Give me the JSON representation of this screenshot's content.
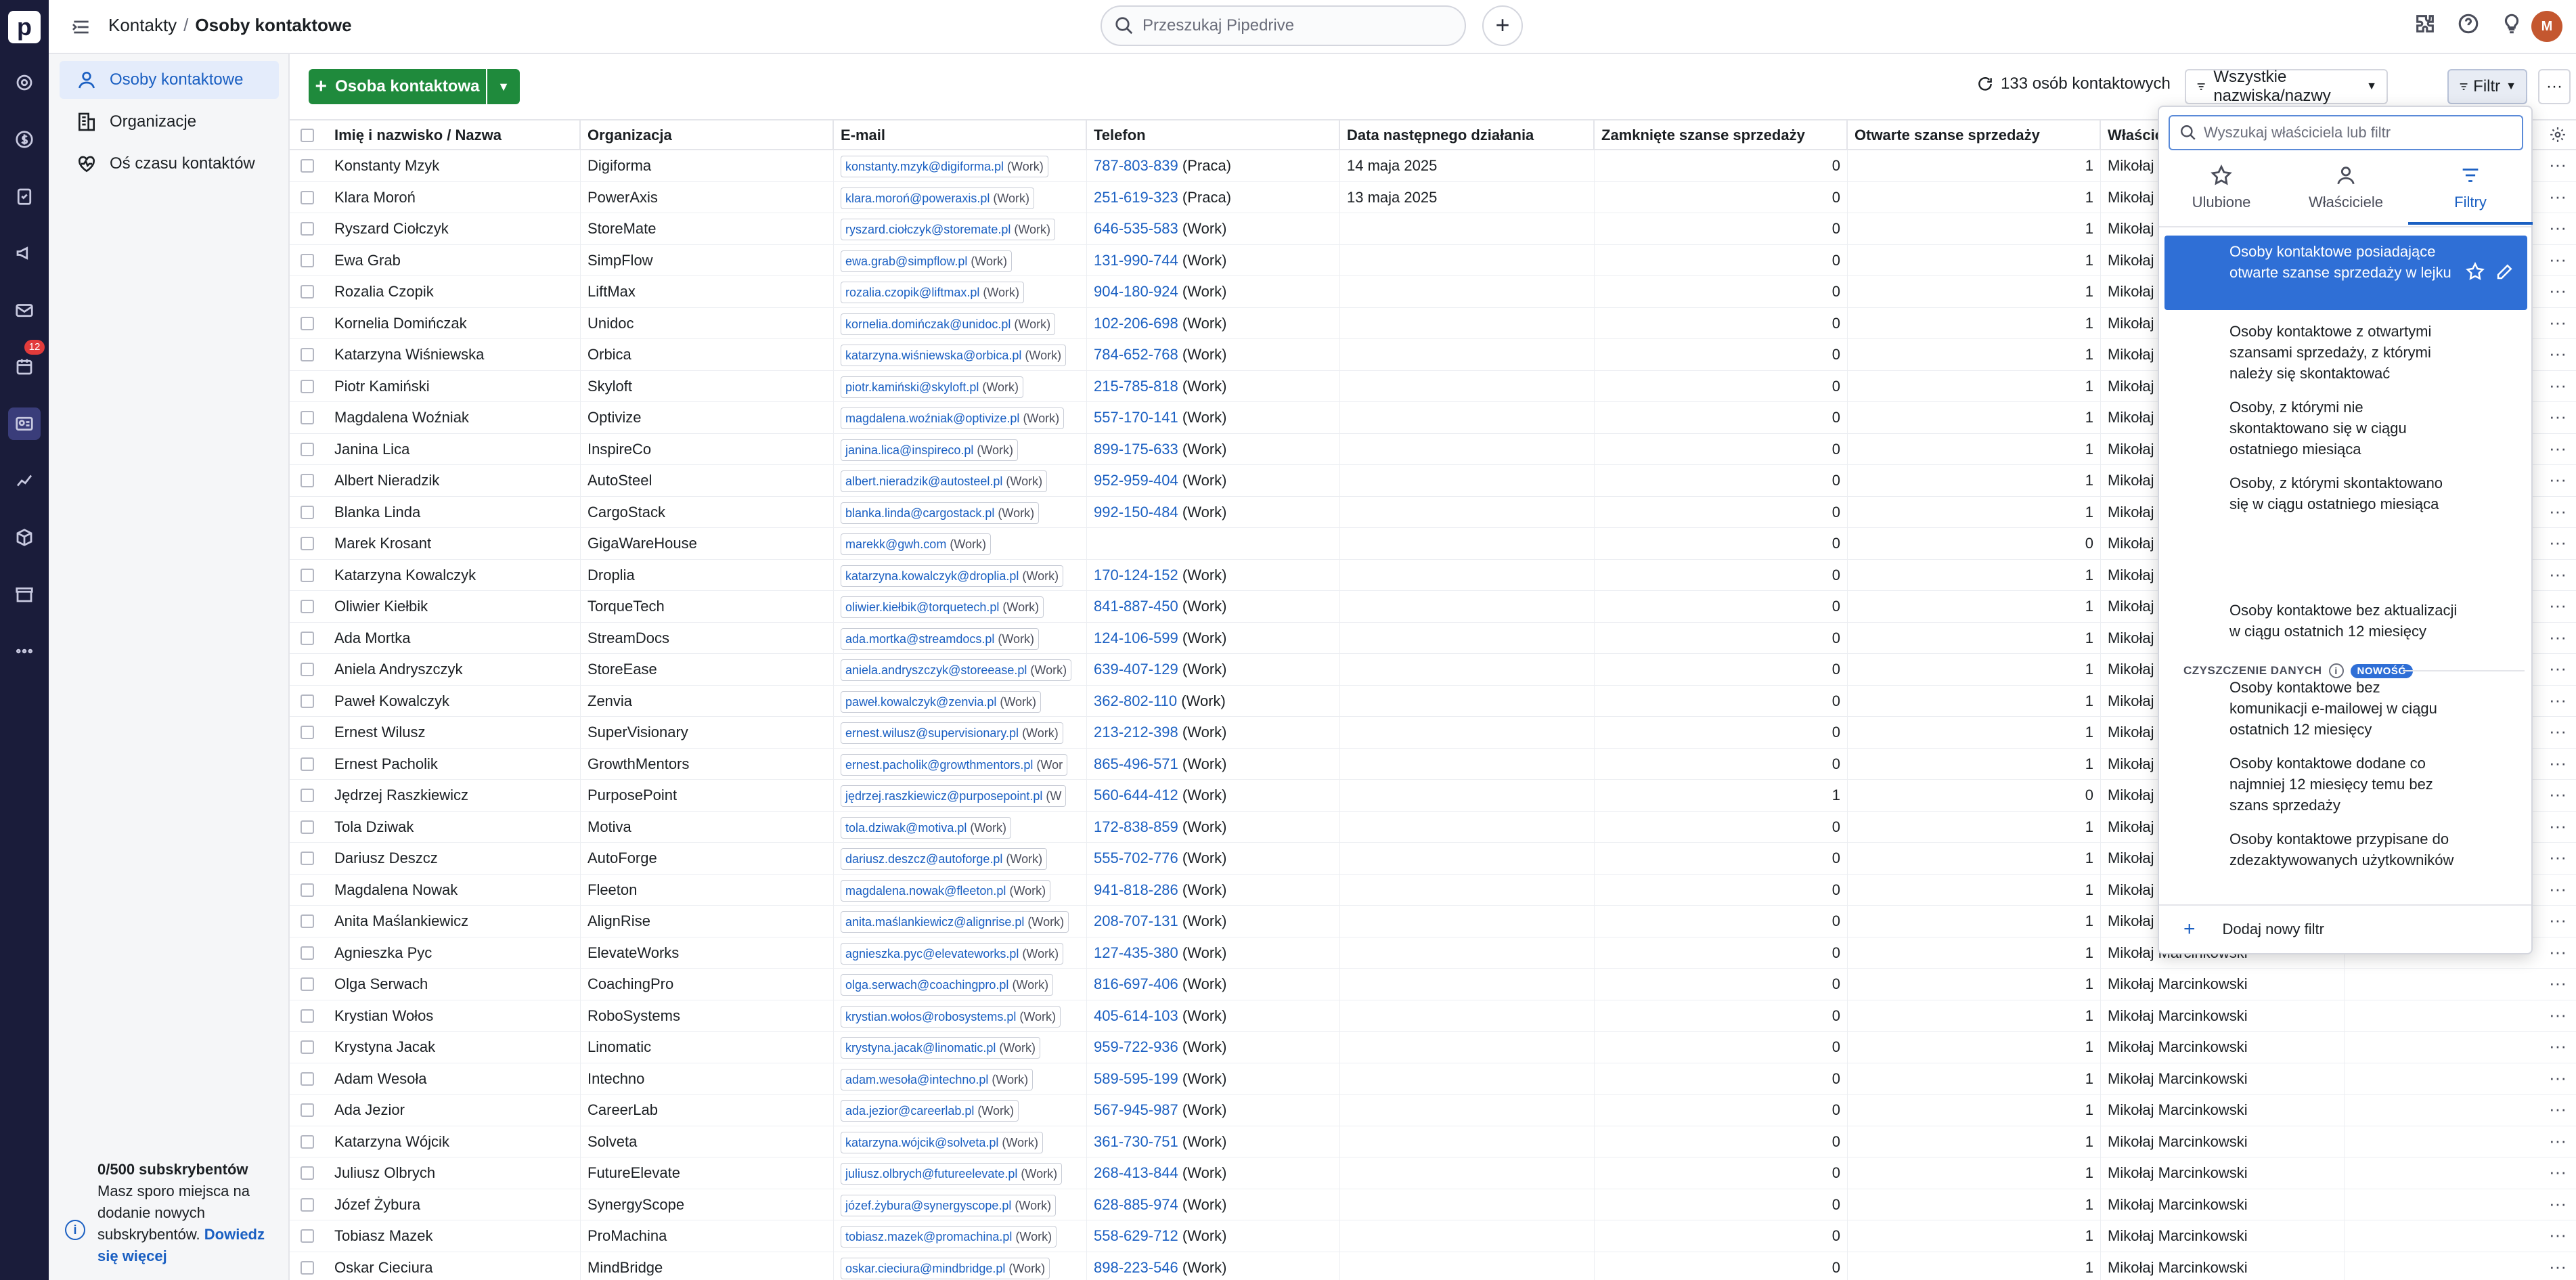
{
  "rail": {
    "logo": "p",
    "badge": "12"
  },
  "header": {
    "breadcrumb_parent": "Kontakty",
    "breadcrumb_separator": "/",
    "breadcrumb_current": "Osoby kontaktowe",
    "search_placeholder": "Przeszukaj Pipedrive",
    "add_label": "+"
  },
  "sidebar": {
    "items": [
      {
        "label": "Osoby kontaktowe",
        "icon": "person-icon",
        "active": true
      },
      {
        "label": "Organizacje",
        "icon": "building-icon",
        "active": false
      },
      {
        "label": "Oś czasu kontaktów",
        "icon": "heart-pulse-icon",
        "active": false
      }
    ],
    "subs_title": "0/500 subskrybentów",
    "subs_text": "Masz sporo miejsca na dodanie nowych subskrybentów.",
    "subs_link": "Dowiedz się więcej"
  },
  "toolbar": {
    "add_button": "Osoba kontaktowa",
    "count": "133 osób kontaktowych",
    "owner_filter": "Wszystkie nazwiska/nazwy",
    "filter_button": "Filtr",
    "more": "···"
  },
  "table": {
    "columns": [
      "Imię i nazwisko / Nazwa",
      "Organizacja",
      "E-mail",
      "Telefon",
      "Data następnego działania",
      "Zamknięte szanse sprzedaży",
      "Otwarte szanse sprzedaży",
      "Właściciel"
    ],
    "rows": [
      {
        "name": "Konstanty Mzyk",
        "org": "Digiforma",
        "email": "konstanty.mzyk@digiforma.pl",
        "email_label": "(Work)",
        "phone": "787-803-839",
        "phone_label": "(Praca)",
        "next": "14 maja 2025",
        "closed": "0",
        "open": "1",
        "owner": "Mikołaj Marcinkowski"
      },
      {
        "name": "Klara Moroń",
        "org": "PowerAxis",
        "email": "klara.moroń@poweraxis.pl",
        "email_label": "(Work)",
        "phone": "251-619-323",
        "phone_label": "(Praca)",
        "next": "13 maja 2025",
        "closed": "0",
        "open": "1",
        "owner": "Mikołaj Marcinkowski"
      },
      {
        "name": "Ryszard Ciołczyk",
        "org": "StoreMate",
        "email": "ryszard.ciołczyk@storemate.pl",
        "email_label": "(Work)",
        "phone": "646-535-583",
        "phone_label": "(Work)",
        "next": "",
        "closed": "0",
        "open": "1",
        "owner": "Mikołaj Marcinkowski"
      },
      {
        "name": "Ewa Grab",
        "org": "SimpFlow",
        "email": "ewa.grab@simpflow.pl",
        "email_label": "(Work)",
        "phone": "131-990-744",
        "phone_label": "(Work)",
        "next": "",
        "closed": "0",
        "open": "1",
        "owner": "Mikołaj Marcinkowski"
      },
      {
        "name": "Rozalia Czopik",
        "org": "LiftMax",
        "email": "rozalia.czopik@liftmax.pl",
        "email_label": "(Work)",
        "phone": "904-180-924",
        "phone_label": "(Work)",
        "next": "",
        "closed": "0",
        "open": "1",
        "owner": "Mikołaj Marcinkowski"
      },
      {
        "name": "Kornelia Domińczak",
        "org": "Unidoc",
        "email": "kornelia.domińczak@unidoc.pl",
        "email_label": "(Work)",
        "phone": "102-206-698",
        "phone_label": "(Work)",
        "next": "",
        "closed": "0",
        "open": "1",
        "owner": "Mikołaj Marcinkowski"
      },
      {
        "name": "Katarzyna Wiśniewska",
        "org": "Orbica",
        "email": "katarzyna.wiśniewska@orbica.pl",
        "email_label": "(Work)",
        "phone": "784-652-768",
        "phone_label": "(Work)",
        "next": "",
        "closed": "0",
        "open": "1",
        "owner": "Mikołaj Marcinkowski"
      },
      {
        "name": "Piotr Kamiński",
        "org": "Skyloft",
        "email": "piotr.kamiński@skyloft.pl",
        "email_label": "(Work)",
        "phone": "215-785-818",
        "phone_label": "(Work)",
        "next": "",
        "closed": "0",
        "open": "1",
        "owner": "Mikołaj Marcinkowski"
      },
      {
        "name": "Magdalena Woźniak",
        "org": "Optivize",
        "email": "magdalena.woźniak@optivize.pl",
        "email_label": "(Work)",
        "phone": "557-170-141",
        "phone_label": "(Work)",
        "next": "",
        "closed": "0",
        "open": "1",
        "owner": "Mikołaj Marcinkowski"
      },
      {
        "name": "Janina Lica",
        "org": "InspireCo",
        "email": "janina.lica@inspireco.pl",
        "email_label": "(Work)",
        "phone": "899-175-633",
        "phone_label": "(Work)",
        "next": "",
        "closed": "0",
        "open": "1",
        "owner": "Mikołaj Marcinkowski"
      },
      {
        "name": "Albert Nieradzik",
        "org": "AutoSteel",
        "email": "albert.nieradzik@autosteel.pl",
        "email_label": "(Work)",
        "phone": "952-959-404",
        "phone_label": "(Work)",
        "next": "",
        "closed": "0",
        "open": "1",
        "owner": "Mikołaj Marcinkowski"
      },
      {
        "name": "Blanka Linda",
        "org": "CargoStack",
        "email": "blanka.linda@cargostack.pl",
        "email_label": "(Work)",
        "phone": "992-150-484",
        "phone_label": "(Work)",
        "next": "",
        "closed": "0",
        "open": "1",
        "owner": "Mikołaj Marcinkowski"
      },
      {
        "name": "Marek Krosant",
        "org": "GigaWareHouse",
        "email": "marekk@gwh.com",
        "email_label": "(Work)",
        "phone": "",
        "phone_label": "",
        "next": "",
        "closed": "0",
        "open": "0",
        "owner": "Mikołaj Marcinkowski"
      },
      {
        "name": "Katarzyna Kowalczyk",
        "org": "Droplia",
        "email": "katarzyna.kowalczyk@droplia.pl",
        "email_label": "(Work)",
        "phone": "170-124-152",
        "phone_label": "(Work)",
        "next": "",
        "closed": "0",
        "open": "1",
        "owner": "Mikołaj Marcinkowski"
      },
      {
        "name": "Oliwier Kiełbik",
        "org": "TorqueTech",
        "email": "oliwier.kiełbik@torquetech.pl",
        "email_label": "(Work)",
        "phone": "841-887-450",
        "phone_label": "(Work)",
        "next": "",
        "closed": "0",
        "open": "1",
        "owner": "Mikołaj Marcinkowski"
      },
      {
        "name": "Ada Mortka",
        "org": "StreamDocs",
        "email": "ada.mortka@streamdocs.pl",
        "email_label": "(Work)",
        "phone": "124-106-599",
        "phone_label": "(Work)",
        "next": "",
        "closed": "0",
        "open": "1",
        "owner": "Mikołaj Marcinkowski"
      },
      {
        "name": "Aniela Andryszczyk",
        "org": "StoreEase",
        "email": "aniela.andryszczyk@storeease.pl",
        "email_label": "(Work)",
        "phone": "639-407-129",
        "phone_label": "(Work)",
        "next": "",
        "closed": "0",
        "open": "1",
        "owner": "Mikołaj Marcinkowski"
      },
      {
        "name": "Paweł Kowalczyk",
        "org": "Zenvia",
        "email": "paweł.kowalczyk@zenvia.pl",
        "email_label": "(Work)",
        "phone": "362-802-110",
        "phone_label": "(Work)",
        "next": "",
        "closed": "0",
        "open": "1",
        "owner": "Mikołaj Marcinkowski"
      },
      {
        "name": "Ernest Wilusz",
        "org": "SuperVisionary",
        "email": "ernest.wilusz@supervisionary.pl",
        "email_label": "(Work)",
        "phone": "213-212-398",
        "phone_label": "(Work)",
        "next": "",
        "closed": "0",
        "open": "1",
        "owner": "Mikołaj Marcinkowski"
      },
      {
        "name": "Ernest Pacholik",
        "org": "GrowthMentors",
        "email": "ernest.pacholik@growthmentors.pl",
        "email_label": "(Wor",
        "phone": "865-496-571",
        "phone_label": "(Work)",
        "next": "",
        "closed": "0",
        "open": "1",
        "owner": "Mikołaj Marcinkowski"
      },
      {
        "name": "Jędrzej Raszkiewicz",
        "org": "PurposePoint",
        "email": "jędrzej.raszkiewicz@purposepoint.pl",
        "email_label": "(W",
        "phone": "560-644-412",
        "phone_label": "(Work)",
        "next": "",
        "closed": "1",
        "open": "0",
        "owner": "Mikołaj Marcinkowski"
      },
      {
        "name": "Tola Dziwak",
        "org": "Motiva",
        "email": "tola.dziwak@motiva.pl",
        "email_label": "(Work)",
        "phone": "172-838-859",
        "phone_label": "(Work)",
        "next": "",
        "closed": "0",
        "open": "1",
        "owner": "Mikołaj Marcinkowski"
      },
      {
        "name": "Dariusz Deszcz",
        "org": "AutoForge",
        "email": "dariusz.deszcz@autoforge.pl",
        "email_label": "(Work)",
        "phone": "555-702-776",
        "phone_label": "(Work)",
        "next": "",
        "closed": "0",
        "open": "1",
        "owner": "Mikołaj Marcinkowski"
      },
      {
        "name": "Magdalena Nowak",
        "org": "Fleeton",
        "email": "magdalena.nowak@fleeton.pl",
        "email_label": "(Work)",
        "phone": "941-818-286",
        "phone_label": "(Work)",
        "next": "",
        "closed": "0",
        "open": "1",
        "owner": "Mikołaj Marcinkowski"
      },
      {
        "name": "Anita Maślankiewicz",
        "org": "AlignRise",
        "email": "anita.maślankiewicz@alignrise.pl",
        "email_label": "(Work)",
        "phone": "208-707-131",
        "phone_label": "(Work)",
        "next": "",
        "closed": "0",
        "open": "1",
        "owner": "Mikołaj Marcinkowski"
      },
      {
        "name": "Agnieszka Pyc",
        "org": "ElevateWorks",
        "email": "agnieszka.pyc@elevateworks.pl",
        "email_label": "(Work)",
        "phone": "127-435-380",
        "phone_label": "(Work)",
        "next": "",
        "closed": "0",
        "open": "1",
        "owner": "Mikołaj Marcinkowski"
      },
      {
        "name": "Olga Serwach",
        "org": "CoachingPro",
        "email": "olga.serwach@coachingpro.pl",
        "email_label": "(Work)",
        "phone": "816-697-406",
        "phone_label": "(Work)",
        "next": "",
        "closed": "0",
        "open": "1",
        "owner": "Mikołaj Marcinkowski"
      },
      {
        "name": "Krystian Wołos",
        "org": "RoboSystems",
        "email": "krystian.wołos@robosystems.pl",
        "email_label": "(Work)",
        "phone": "405-614-103",
        "phone_label": "(Work)",
        "next": "",
        "closed": "0",
        "open": "1",
        "owner": "Mikołaj Marcinkowski"
      },
      {
        "name": "Krystyna Jacak",
        "org": "Linomatic",
        "email": "krystyna.jacak@linomatic.pl",
        "email_label": "(Work)",
        "phone": "959-722-936",
        "phone_label": "(Work)",
        "next": "",
        "closed": "0",
        "open": "1",
        "owner": "Mikołaj Marcinkowski"
      },
      {
        "name": "Adam Wesoła",
        "org": "Intechno",
        "email": "adam.wesoła@intechno.pl",
        "email_label": "(Work)",
        "phone": "589-595-199",
        "phone_label": "(Work)",
        "next": "",
        "closed": "0",
        "open": "1",
        "owner": "Mikołaj Marcinkowski"
      },
      {
        "name": "Ada Jezior",
        "org": "CareerLab",
        "email": "ada.jezior@careerlab.pl",
        "email_label": "(Work)",
        "phone": "567-945-987",
        "phone_label": "(Work)",
        "next": "",
        "closed": "0",
        "open": "1",
        "owner": "Mikołaj Marcinkowski"
      },
      {
        "name": "Katarzyna Wójcik",
        "org": "Solveta",
        "email": "katarzyna.wójcik@solveta.pl",
        "email_label": "(Work)",
        "phone": "361-730-751",
        "phone_label": "(Work)",
        "next": "",
        "closed": "0",
        "open": "1",
        "owner": "Mikołaj Marcinkowski"
      },
      {
        "name": "Juliusz Olbrych",
        "org": "FutureElevate",
        "email": "juliusz.olbrych@futureelevate.pl",
        "email_label": "(Work)",
        "phone": "268-413-844",
        "phone_label": "(Work)",
        "next": "",
        "closed": "0",
        "open": "1",
        "owner": "Mikołaj Marcinkowski"
      },
      {
        "name": "Józef Żybura",
        "org": "SynergyScope",
        "email": "józef.żybura@synergyscope.pl",
        "email_label": "(Work)",
        "phone": "628-885-974",
        "phone_label": "(Work)",
        "next": "",
        "closed": "0",
        "open": "1",
        "owner": "Mikołaj Marcinkowski"
      },
      {
        "name": "Tobiasz Mazek",
        "org": "ProMachina",
        "email": "tobiasz.mazek@promachina.pl",
        "email_label": "(Work)",
        "phone": "558-629-712",
        "phone_label": "(Work)",
        "next": "",
        "closed": "0",
        "open": "1",
        "owner": "Mikołaj Marcinkowski"
      },
      {
        "name": "Oskar Cieciura",
        "org": "MindBridge",
        "email": "oskar.cieciura@mindbridge.pl",
        "email_label": "(Work)",
        "phone": "898-223-546",
        "phone_label": "(Work)",
        "next": "",
        "closed": "0",
        "open": "1",
        "owner": "Mikołaj Marcinkowski"
      }
    ]
  },
  "dropdown": {
    "search_placeholder": "Wyszukaj właściciela lub filtr",
    "tabs": [
      {
        "label": "Ulubione",
        "icon": "star-icon"
      },
      {
        "label": "Właściciele",
        "icon": "person-icon"
      },
      {
        "label": "Filtry",
        "icon": "filter-icon"
      }
    ],
    "filters": [
      "Osoby kontaktowe posiadające otwarte szanse sprzedaży w lejku",
      "Osoby kontaktowe z otwartymi szansami sprzedaży, z którymi należy się skontaktować",
      "Osoby, z którymi nie skontaktowano się w ciągu ostatniego miesiąca",
      "Osoby, z którymi skontaktowano się w ciągu ostatniego miesiąca"
    ],
    "section_title": "CZYSZCZENIE DANYCH",
    "section_badge": "NOWOŚĆ",
    "cleanup_filters": [
      "Osoby kontaktowe bez aktualizacji w ciągu ostatnich 12 miesięcy",
      "Osoby kontaktowe bez komunikacji e-mailowej w ciągu ostatnich 12 miesięcy",
      "Osoby kontaktowe dodane co najmniej 12 miesięcy temu bez szans sprzedaży",
      "Osoby kontaktowe przypisane do zdezaktywowanych użytkowników"
    ],
    "add_filter": "Dodaj nowy filtr"
  },
  "colors": {
    "rail": "#1a1c3a",
    "accent": "#2f6fd6",
    "add_button": "#1f8a3c",
    "badge": "#e23b3b"
  }
}
